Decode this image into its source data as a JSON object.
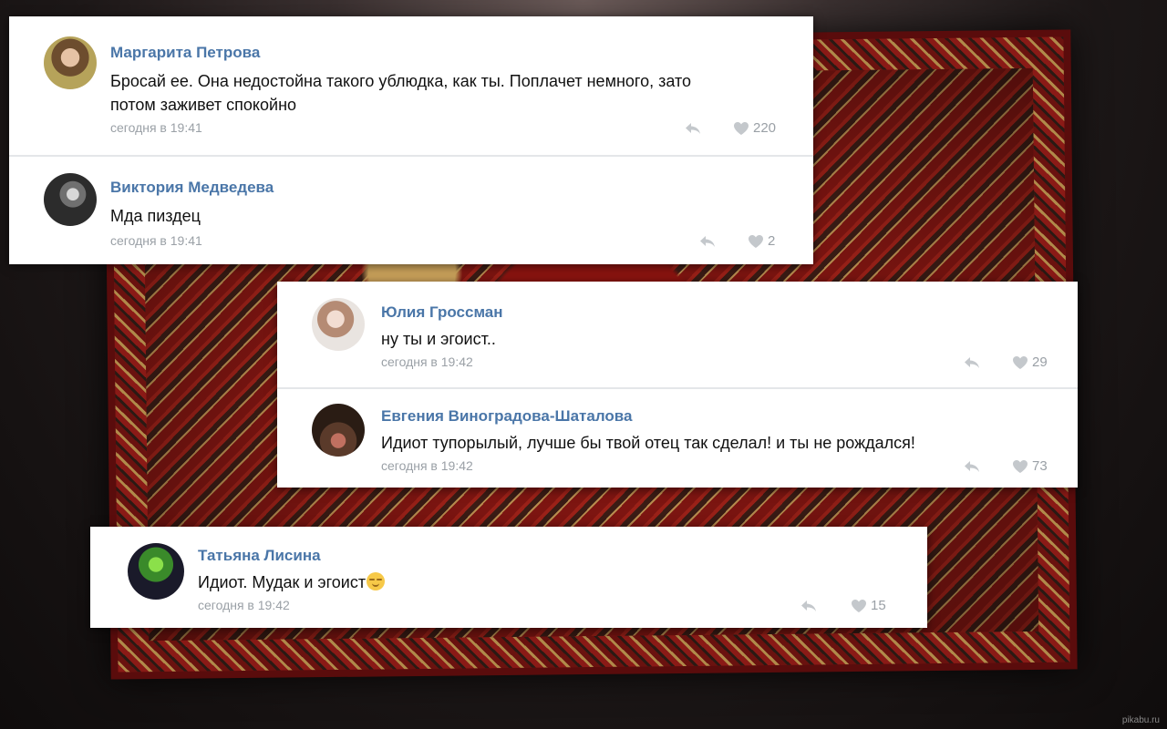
{
  "watermark": "pikabu.ru",
  "colors": {
    "name": "#4a76a8",
    "meta": "#9aa0a6",
    "text": "#111111"
  },
  "cards": [
    {
      "comments": [
        {
          "author": "Маргарита Петрова",
          "text_lines": [
            "Бросай ее. Она недостойна такого ублюдка, как ты. Поплачет немного, зато",
            "потом заживет спокойно"
          ],
          "date": "сегодня в 19:41",
          "likes": "220",
          "avatar_icon": "user-avatar"
        },
        {
          "author": "Виктория Медведева",
          "text_lines": [
            "Мда пиздец"
          ],
          "date": "сегодня в 19:41",
          "likes": "2",
          "avatar_icon": "user-avatar"
        }
      ]
    },
    {
      "comments": [
        {
          "author": "Юлия Гроссман",
          "text_lines": [
            "ну ты и эгоист.."
          ],
          "date": "сегодня в 19:42",
          "likes": "29",
          "avatar_icon": "user-avatar"
        },
        {
          "author": "Евгения Виноградова-Шаталова",
          "text_lines": [
            "Идиот тупорылый, лучше бы твой отец так сделал! и ты не рождался!"
          ],
          "date": "сегодня в 19:42",
          "likes": "73",
          "avatar_icon": "user-avatar"
        }
      ]
    },
    {
      "comments": [
        {
          "author": "Татьяна Лисина",
          "text_lines": [
            "Идиот. Мудак и эгоист"
          ],
          "date": "сегодня в 19:42",
          "likes": "15",
          "avatar_icon": "user-avatar",
          "trailing_emoji": "relieved-face-emoji"
        }
      ]
    }
  ]
}
